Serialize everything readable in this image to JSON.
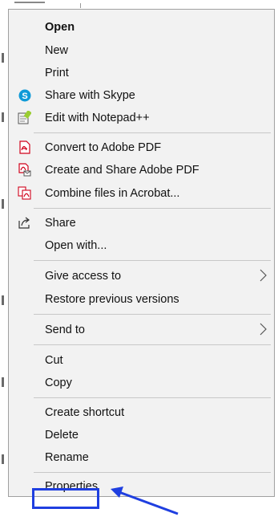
{
  "menu": {
    "items": [
      {
        "label": "Open",
        "bold": true,
        "icon": ""
      },
      {
        "label": "New",
        "icon": ""
      },
      {
        "label": "Print",
        "icon": ""
      },
      {
        "label": "Share with Skype",
        "icon": "skype-icon"
      },
      {
        "label": "Edit with Notepad++",
        "icon": "notepad-plus-plus-icon"
      },
      {
        "label": "Convert to Adobe PDF",
        "icon": "adobe-pdf-icon"
      },
      {
        "label": "Create and Share Adobe PDF",
        "icon": "adobe-pdf-share-icon"
      },
      {
        "label": "Combine files in Acrobat...",
        "icon": "acrobat-combine-icon"
      },
      {
        "label": "Share",
        "icon": "share-icon"
      },
      {
        "label": "Open with...",
        "icon": ""
      },
      {
        "label": "Give access to",
        "icon": "",
        "submenu": true
      },
      {
        "label": "Restore previous versions",
        "icon": ""
      },
      {
        "label": "Send to",
        "icon": "",
        "submenu": true
      },
      {
        "label": "Cut",
        "icon": ""
      },
      {
        "label": "Copy",
        "icon": ""
      },
      {
        "label": "Create shortcut",
        "icon": ""
      },
      {
        "label": "Delete",
        "icon": ""
      },
      {
        "label": "Rename",
        "icon": ""
      },
      {
        "label": "Properties",
        "icon": ""
      }
    ]
  },
  "colors": {
    "menu_bg": "#f2f2f2",
    "highlight": "#1f3fe0",
    "skype": "#0f9ad7",
    "adobe_red": "#d0021b"
  },
  "annotation": {
    "highlighted_item": "Properties"
  }
}
